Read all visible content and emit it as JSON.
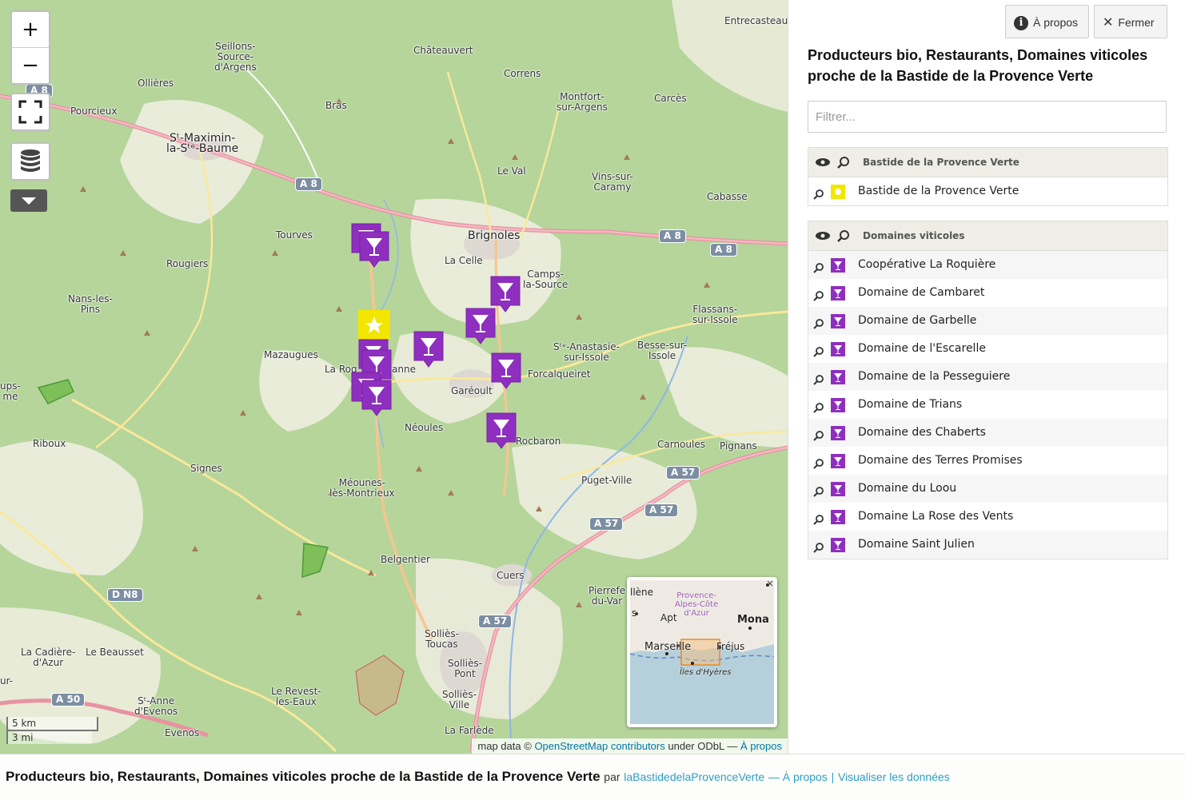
{
  "map": {
    "controls": {
      "zoom_in": "+",
      "zoom_out": "−"
    },
    "places": [
      {
        "id": "p1",
        "name": "Seillons-\nSource-\nd'Argens"
      },
      {
        "id": "p2",
        "name": "Châteauvert"
      },
      {
        "id": "p3",
        "name": "Entrecasteaux"
      },
      {
        "id": "p4",
        "name": "Ollières"
      },
      {
        "id": "p5",
        "name": "Correns"
      },
      {
        "id": "p6",
        "name": "Montfort-\nsur-Argens"
      },
      {
        "id": "p7",
        "name": "Carcès"
      },
      {
        "id": "p8",
        "name": "Pourcieux"
      },
      {
        "id": "p9",
        "name": "Bras"
      },
      {
        "id": "p10",
        "name": "Sᵗ-Maximin-\nla-Sᵗᵉ-Baume"
      },
      {
        "id": "p11",
        "name": "Le Val"
      },
      {
        "id": "p12",
        "name": "Vins-sur-\nCaramy"
      },
      {
        "id": "p13",
        "name": "Cabasse"
      },
      {
        "id": "p14",
        "name": "Tourves"
      },
      {
        "id": "p15",
        "name": "Brignoles"
      },
      {
        "id": "p16",
        "name": "La Celle"
      },
      {
        "id": "p17",
        "name": "Rougiers"
      },
      {
        "id": "p18",
        "name": "Camps-\nla-Source"
      },
      {
        "id": "p19",
        "name": "Nans-les-\nPins"
      },
      {
        "id": "p20",
        "name": "Flassans-\nsur-Issole"
      },
      {
        "id": "p21",
        "name": "Mazaugues"
      },
      {
        "id": "p22",
        "name": "Sᵗᵉ-Anastasie-\nsur-Issole"
      },
      {
        "id": "p23",
        "name": "Besse-sur-\nIssole"
      },
      {
        "id": "p24",
        "name": "La Roq"
      },
      {
        "id": "p25",
        "name": "anne"
      },
      {
        "id": "p26",
        "name": "Forcalqueiret"
      },
      {
        "id": "p27",
        "name": "Garéoult"
      },
      {
        "id": "p28",
        "name": "ups-\nme"
      },
      {
        "id": "p29",
        "name": "Néoules"
      },
      {
        "id": "p30",
        "name": "Rocbaron"
      },
      {
        "id": "p31",
        "name": "Carnoules"
      },
      {
        "id": "p32",
        "name": "Pignans"
      },
      {
        "id": "p33",
        "name": "Riboux"
      },
      {
        "id": "p34",
        "name": "Signes"
      },
      {
        "id": "p35",
        "name": "Puget-Ville"
      },
      {
        "id": "p36",
        "name": "Méounes-\nlès-Montrieux"
      },
      {
        "id": "p37",
        "name": "Belgentier"
      },
      {
        "id": "p38",
        "name": "Cuers"
      },
      {
        "id": "p39",
        "name": "Pierrefe\ndu-Var"
      },
      {
        "id": "p40",
        "name": "Solliès-\nToucas"
      },
      {
        "id": "p41",
        "name": "La Cadière-\nd'Azur"
      },
      {
        "id": "p42",
        "name": "Le Beausset"
      },
      {
        "id": "p43",
        "name": "Solliès-\nPont"
      },
      {
        "id": "p44",
        "name": "Le Revest-\nles-Eaux"
      },
      {
        "id": "p45",
        "name": "Solliès-\nVille"
      },
      {
        "id": "p46",
        "name": "Sᵗ-Anne\nd'Evenos"
      },
      {
        "id": "p47",
        "name": "Evenos"
      },
      {
        "id": "p48",
        "name": "La Farlède"
      },
      {
        "id": "p49",
        "name": "ur-"
      }
    ],
    "shields": [
      {
        "id": "s1",
        "label": "A 8"
      },
      {
        "id": "s2",
        "label": "A 8"
      },
      {
        "id": "s3",
        "label": "A 8"
      },
      {
        "id": "s4",
        "label": "A 8"
      },
      {
        "id": "s5",
        "label": "A 57"
      },
      {
        "id": "s6",
        "label": "A 57"
      },
      {
        "id": "s7",
        "label": "A 57"
      },
      {
        "id": "s8",
        "label": "A 57"
      },
      {
        "id": "s9",
        "label": "D N8"
      },
      {
        "id": "s10",
        "label": "A 50"
      }
    ],
    "minimap": {
      "labels": [
        "llène",
        "Provence-\nAlpes-Côte\nd'Azur",
        "Apt",
        "Mona",
        "Marseille",
        "Fréjus",
        "Îles d'Hyères",
        "s"
      ],
      "close": "×"
    },
    "scale": {
      "km": "5 km",
      "mi": "3 mi"
    },
    "attribution": {
      "prefix": "map data ©",
      "osm": "OpenStreetMap contributors",
      "license": "under ODbL —",
      "about": "À propos"
    }
  },
  "panel": {
    "about_button": "À propos",
    "close_button": "Fermer",
    "title": "Producteurs bio, Restaurants, Domaines viticoles proche de la Bastide de la Provence Verte",
    "filter_placeholder": "Filtrer...",
    "layers": [
      {
        "name": "Bastide de la Provence Verte",
        "color": "#f2e600",
        "items": [
          "Bastide de la Provence Verte"
        ]
      },
      {
        "name": "Domaines viticoles",
        "color": "#8e2fbf",
        "items": [
          "Coopérative La Roquière",
          "Domaine de Cambaret",
          "Domaine de Garbelle",
          "Domaine de l'Escarelle",
          "Domaine de la Pesseguiere",
          "Domaine de Trians",
          "Domaine des Chaberts",
          "Domaine des Terres Promises",
          "Domaine du Loou",
          "Domaine La Rose des Vents",
          "Domaine Saint Julien"
        ]
      }
    ]
  },
  "footer": {
    "title": "Producteurs bio, Restaurants, Domaines viticoles proche de la Bastide de la Provence Verte",
    "by": "par",
    "author_link": "laBastidedelaProvenceVerte",
    "about_link": "— À propos",
    "sep": "|",
    "data_link": "Visualiser les données"
  }
}
